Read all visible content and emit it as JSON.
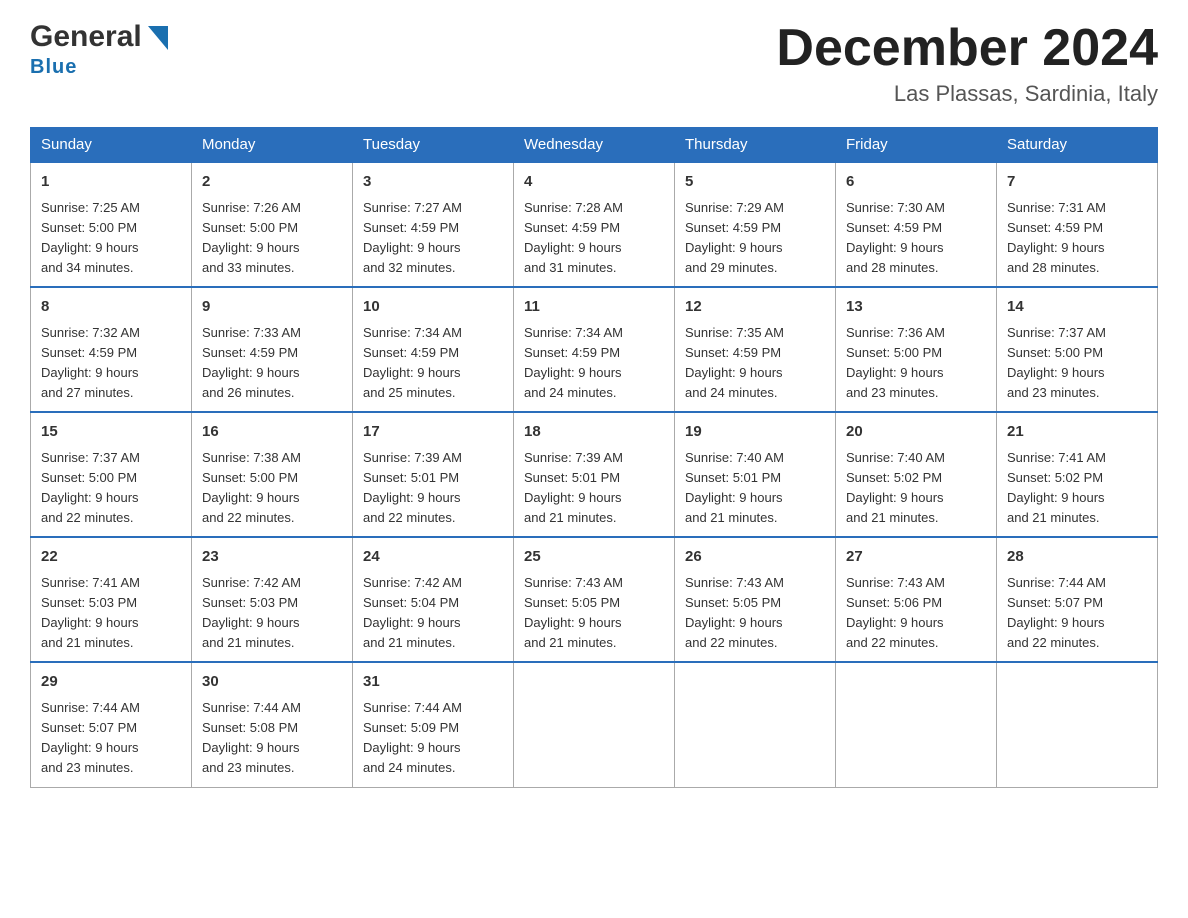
{
  "header": {
    "logo_general": "General",
    "logo_blue": "Blue",
    "month_title": "December 2024",
    "location": "Las Plassas, Sardinia, Italy"
  },
  "weekdays": [
    "Sunday",
    "Monday",
    "Tuesday",
    "Wednesday",
    "Thursday",
    "Friday",
    "Saturday"
  ],
  "weeks": [
    [
      {
        "day": "1",
        "info": "Sunrise: 7:25 AM\nSunset: 5:00 PM\nDaylight: 9 hours\nand 34 minutes."
      },
      {
        "day": "2",
        "info": "Sunrise: 7:26 AM\nSunset: 5:00 PM\nDaylight: 9 hours\nand 33 minutes."
      },
      {
        "day": "3",
        "info": "Sunrise: 7:27 AM\nSunset: 4:59 PM\nDaylight: 9 hours\nand 32 minutes."
      },
      {
        "day": "4",
        "info": "Sunrise: 7:28 AM\nSunset: 4:59 PM\nDaylight: 9 hours\nand 31 minutes."
      },
      {
        "day": "5",
        "info": "Sunrise: 7:29 AM\nSunset: 4:59 PM\nDaylight: 9 hours\nand 29 minutes."
      },
      {
        "day": "6",
        "info": "Sunrise: 7:30 AM\nSunset: 4:59 PM\nDaylight: 9 hours\nand 28 minutes."
      },
      {
        "day": "7",
        "info": "Sunrise: 7:31 AM\nSunset: 4:59 PM\nDaylight: 9 hours\nand 28 minutes."
      }
    ],
    [
      {
        "day": "8",
        "info": "Sunrise: 7:32 AM\nSunset: 4:59 PM\nDaylight: 9 hours\nand 27 minutes."
      },
      {
        "day": "9",
        "info": "Sunrise: 7:33 AM\nSunset: 4:59 PM\nDaylight: 9 hours\nand 26 minutes."
      },
      {
        "day": "10",
        "info": "Sunrise: 7:34 AM\nSunset: 4:59 PM\nDaylight: 9 hours\nand 25 minutes."
      },
      {
        "day": "11",
        "info": "Sunrise: 7:34 AM\nSunset: 4:59 PM\nDaylight: 9 hours\nand 24 minutes."
      },
      {
        "day": "12",
        "info": "Sunrise: 7:35 AM\nSunset: 4:59 PM\nDaylight: 9 hours\nand 24 minutes."
      },
      {
        "day": "13",
        "info": "Sunrise: 7:36 AM\nSunset: 5:00 PM\nDaylight: 9 hours\nand 23 minutes."
      },
      {
        "day": "14",
        "info": "Sunrise: 7:37 AM\nSunset: 5:00 PM\nDaylight: 9 hours\nand 23 minutes."
      }
    ],
    [
      {
        "day": "15",
        "info": "Sunrise: 7:37 AM\nSunset: 5:00 PM\nDaylight: 9 hours\nand 22 minutes."
      },
      {
        "day": "16",
        "info": "Sunrise: 7:38 AM\nSunset: 5:00 PM\nDaylight: 9 hours\nand 22 minutes."
      },
      {
        "day": "17",
        "info": "Sunrise: 7:39 AM\nSunset: 5:01 PM\nDaylight: 9 hours\nand 22 minutes."
      },
      {
        "day": "18",
        "info": "Sunrise: 7:39 AM\nSunset: 5:01 PM\nDaylight: 9 hours\nand 21 minutes."
      },
      {
        "day": "19",
        "info": "Sunrise: 7:40 AM\nSunset: 5:01 PM\nDaylight: 9 hours\nand 21 minutes."
      },
      {
        "day": "20",
        "info": "Sunrise: 7:40 AM\nSunset: 5:02 PM\nDaylight: 9 hours\nand 21 minutes."
      },
      {
        "day": "21",
        "info": "Sunrise: 7:41 AM\nSunset: 5:02 PM\nDaylight: 9 hours\nand 21 minutes."
      }
    ],
    [
      {
        "day": "22",
        "info": "Sunrise: 7:41 AM\nSunset: 5:03 PM\nDaylight: 9 hours\nand 21 minutes."
      },
      {
        "day": "23",
        "info": "Sunrise: 7:42 AM\nSunset: 5:03 PM\nDaylight: 9 hours\nand 21 minutes."
      },
      {
        "day": "24",
        "info": "Sunrise: 7:42 AM\nSunset: 5:04 PM\nDaylight: 9 hours\nand 21 minutes."
      },
      {
        "day": "25",
        "info": "Sunrise: 7:43 AM\nSunset: 5:05 PM\nDaylight: 9 hours\nand 21 minutes."
      },
      {
        "day": "26",
        "info": "Sunrise: 7:43 AM\nSunset: 5:05 PM\nDaylight: 9 hours\nand 22 minutes."
      },
      {
        "day": "27",
        "info": "Sunrise: 7:43 AM\nSunset: 5:06 PM\nDaylight: 9 hours\nand 22 minutes."
      },
      {
        "day": "28",
        "info": "Sunrise: 7:44 AM\nSunset: 5:07 PM\nDaylight: 9 hours\nand 22 minutes."
      }
    ],
    [
      {
        "day": "29",
        "info": "Sunrise: 7:44 AM\nSunset: 5:07 PM\nDaylight: 9 hours\nand 23 minutes."
      },
      {
        "day": "30",
        "info": "Sunrise: 7:44 AM\nSunset: 5:08 PM\nDaylight: 9 hours\nand 23 minutes."
      },
      {
        "day": "31",
        "info": "Sunrise: 7:44 AM\nSunset: 5:09 PM\nDaylight: 9 hours\nand 24 minutes."
      },
      {
        "day": "",
        "info": ""
      },
      {
        "day": "",
        "info": ""
      },
      {
        "day": "",
        "info": ""
      },
      {
        "day": "",
        "info": ""
      }
    ]
  ]
}
